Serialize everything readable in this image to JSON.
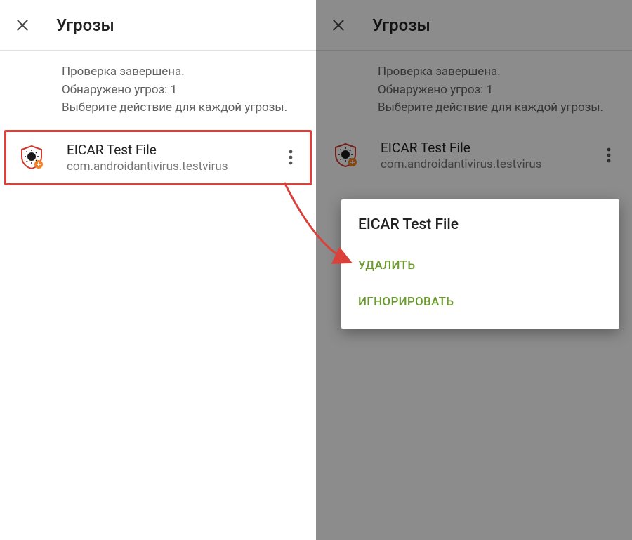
{
  "header": {
    "title": "Угрозы"
  },
  "summary": {
    "line1": "Проверка завершена.",
    "line2": "Обнаружено угроз: 1",
    "line3": "Выберите действие для каждой угрозы."
  },
  "threat": {
    "name": "EICAR Test File",
    "package": "com.androidantivirus.testvirus"
  },
  "menu": {
    "title": "EICAR Test File",
    "delete": "УДАЛИТЬ",
    "ignore": "ИГНОРИРОВАТЬ"
  }
}
